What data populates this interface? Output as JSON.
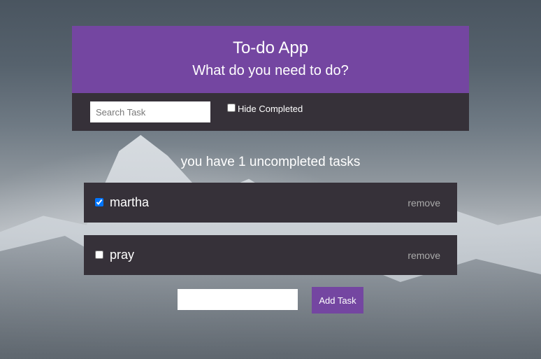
{
  "header": {
    "title": "To-do App",
    "subtitle": "What do you need to do?"
  },
  "toolbar": {
    "search_placeholder": "Search Task",
    "search_value": "",
    "hide_completed_label": "Hide Completed",
    "hide_completed_checked": false
  },
  "status_text": "you have 1 uncompleted tasks",
  "tasks": [
    {
      "name": "martha",
      "completed": true,
      "remove_label": "remove"
    },
    {
      "name": "pray",
      "completed": false,
      "remove_label": "remove"
    }
  ],
  "new_task": {
    "value": "",
    "add_label": "Add Task"
  },
  "colors": {
    "accent": "#7446a1",
    "panel": "#363139",
    "text": "#ffffff",
    "muted": "#aaaaaa"
  }
}
